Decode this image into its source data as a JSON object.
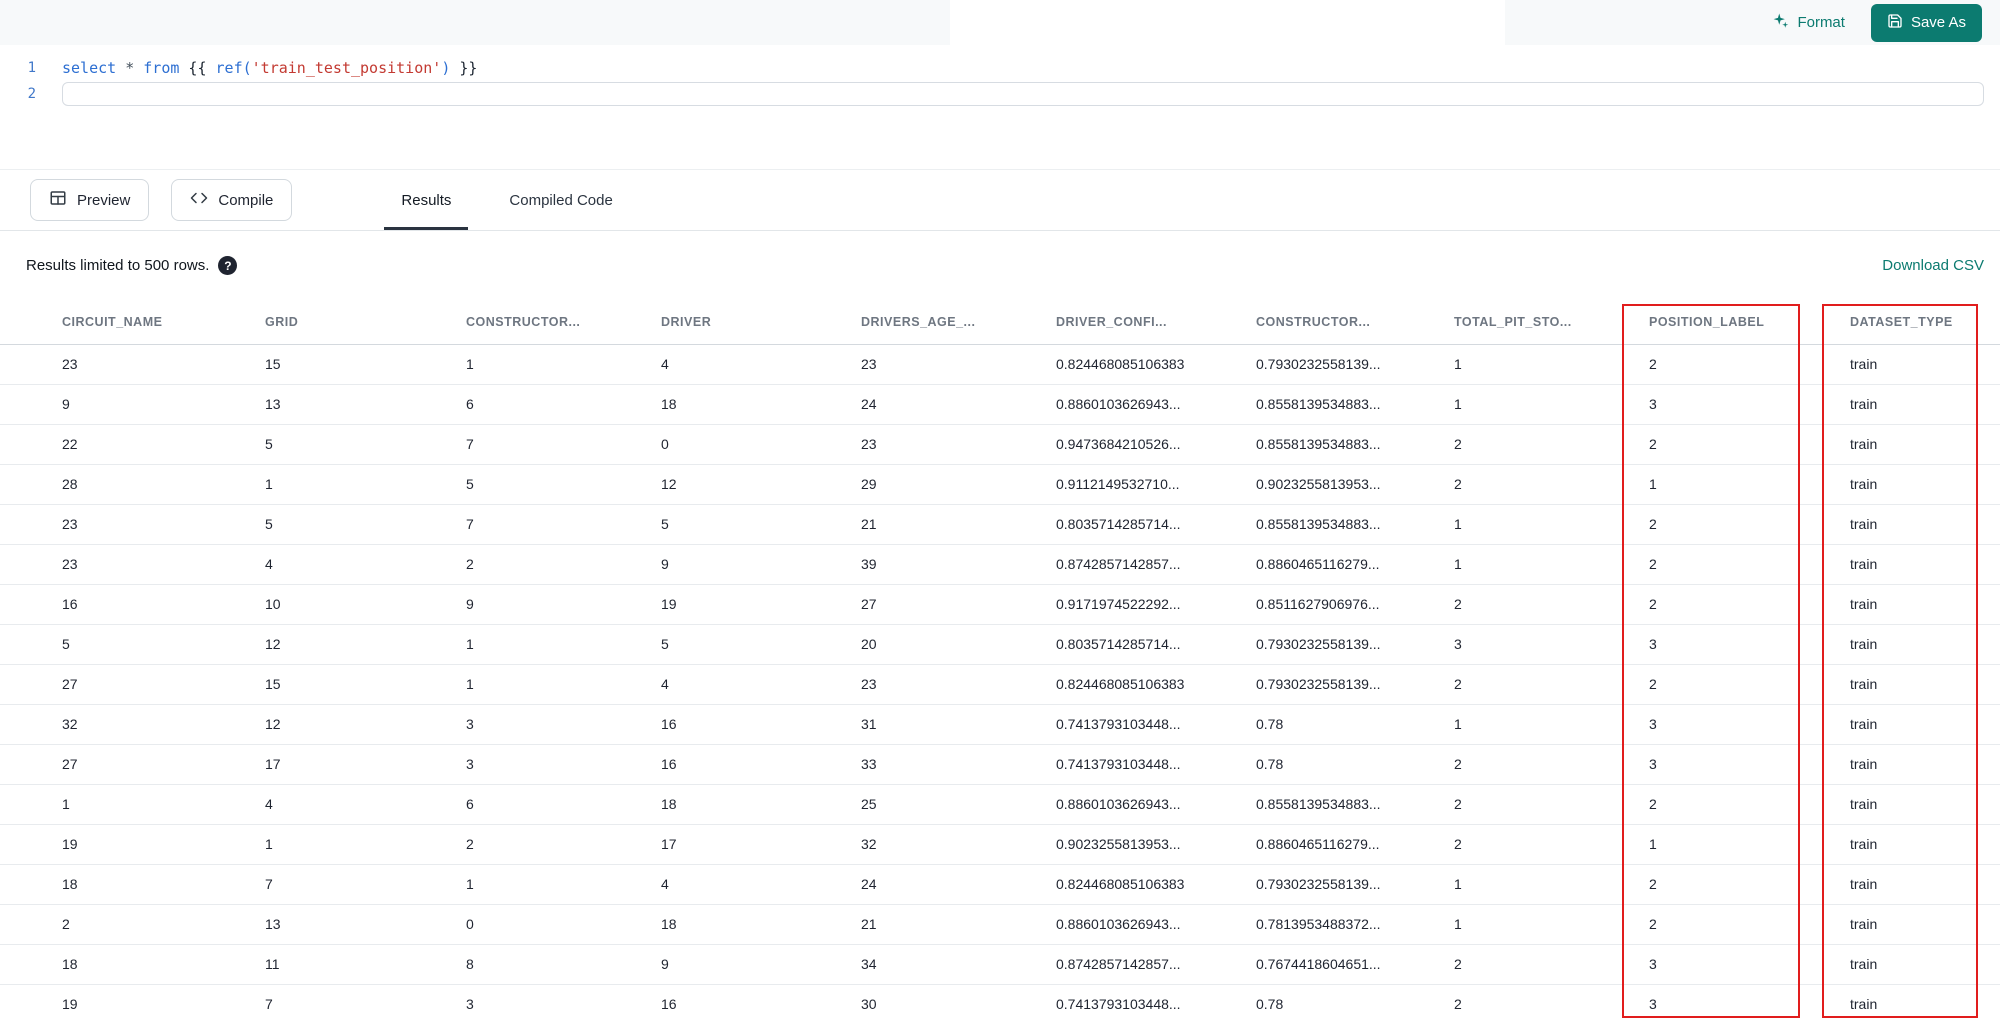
{
  "colors": {
    "accent_teal": "#0c7b70",
    "highlight_red": "#e11d1d"
  },
  "icons": {
    "format": "sparkles-icon",
    "save_as": "save-icon",
    "preview": "table-icon",
    "compile": "code-icon",
    "help": "question-circle-icon"
  },
  "top_bar": {
    "format_label": "Format",
    "save_as_label": "Save As"
  },
  "editor": {
    "line_numbers": [
      "1",
      "2"
    ],
    "code_line": {
      "tokens": [
        {
          "text": "select",
          "type": "keyword"
        },
        {
          "text": " ",
          "type": "plain"
        },
        {
          "text": "*",
          "type": "operator"
        },
        {
          "text": " ",
          "type": "plain"
        },
        {
          "text": "from",
          "type": "keyword"
        },
        {
          "text": " {{ ",
          "type": "plain"
        },
        {
          "text": "ref(",
          "type": "function"
        },
        {
          "text": "'train_test_position'",
          "type": "string"
        },
        {
          "text": ")",
          "type": "function"
        },
        {
          "text": " }}",
          "type": "plain"
        }
      ]
    }
  },
  "toolbar": {
    "preview_label": "Preview",
    "compile_label": "Compile"
  },
  "tabs": [
    {
      "label": "Results",
      "active": true
    },
    {
      "label": "Compiled Code",
      "active": false
    }
  ],
  "results": {
    "limit_text": "Results limited to 500 rows.",
    "help_glyph": "?",
    "download_csv_label": "Download CSV",
    "columns": [
      "CIRCUIT_NAME",
      "GRID",
      "CONSTRUCTOR...",
      "DRIVER",
      "DRIVERS_AGE_...",
      "DRIVER_CONFI...",
      "CONSTRUCTOR...",
      "TOTAL_PIT_STO...",
      "POSITION_LABEL",
      "DATASET_TYPE"
    ],
    "highlighted_columns": [
      "POSITION_LABEL",
      "DATASET_TYPE"
    ],
    "rows": [
      [
        "23",
        "15",
        "1",
        "4",
        "23",
        "0.824468085106383",
        "0.7930232558139...",
        "1",
        "2",
        "train"
      ],
      [
        "9",
        "13",
        "6",
        "18",
        "24",
        "0.8860103626943...",
        "0.8558139534883...",
        "1",
        "3",
        "train"
      ],
      [
        "22",
        "5",
        "7",
        "0",
        "23",
        "0.9473684210526...",
        "0.8558139534883...",
        "2",
        "2",
        "train"
      ],
      [
        "28",
        "1",
        "5",
        "12",
        "29",
        "0.9112149532710...",
        "0.9023255813953...",
        "2",
        "1",
        "train"
      ],
      [
        "23",
        "5",
        "7",
        "5",
        "21",
        "0.8035714285714...",
        "0.8558139534883...",
        "1",
        "2",
        "train"
      ],
      [
        "23",
        "4",
        "2",
        "9",
        "39",
        "0.8742857142857...",
        "0.8860465116279...",
        "1",
        "2",
        "train"
      ],
      [
        "16",
        "10",
        "9",
        "19",
        "27",
        "0.9171974522292...",
        "0.8511627906976...",
        "2",
        "2",
        "train"
      ],
      [
        "5",
        "12",
        "1",
        "5",
        "20",
        "0.8035714285714...",
        "0.7930232558139...",
        "3",
        "3",
        "train"
      ],
      [
        "27",
        "15",
        "1",
        "4",
        "23",
        "0.824468085106383",
        "0.7930232558139...",
        "2",
        "2",
        "train"
      ],
      [
        "32",
        "12",
        "3",
        "16",
        "31",
        "0.7413793103448...",
        "0.78",
        "1",
        "3",
        "train"
      ],
      [
        "27",
        "17",
        "3",
        "16",
        "33",
        "0.7413793103448...",
        "0.78",
        "2",
        "3",
        "train"
      ],
      [
        "1",
        "4",
        "6",
        "18",
        "25",
        "0.8860103626943...",
        "0.8558139534883...",
        "2",
        "2",
        "train"
      ],
      [
        "19",
        "1",
        "2",
        "17",
        "32",
        "0.9023255813953...",
        "0.8860465116279...",
        "2",
        "1",
        "train"
      ],
      [
        "18",
        "7",
        "1",
        "4",
        "24",
        "0.824468085106383",
        "0.7930232558139...",
        "1",
        "2",
        "train"
      ],
      [
        "2",
        "13",
        "0",
        "18",
        "21",
        "0.8860103626943...",
        "0.7813953488372...",
        "1",
        "2",
        "train"
      ],
      [
        "18",
        "11",
        "8",
        "9",
        "34",
        "0.8742857142857...",
        "0.7674418604651...",
        "2",
        "3",
        "train"
      ],
      [
        "19",
        "7",
        "3",
        "16",
        "30",
        "0.7413793103448...",
        "0.78",
        "2",
        "3",
        "train"
      ]
    ]
  }
}
